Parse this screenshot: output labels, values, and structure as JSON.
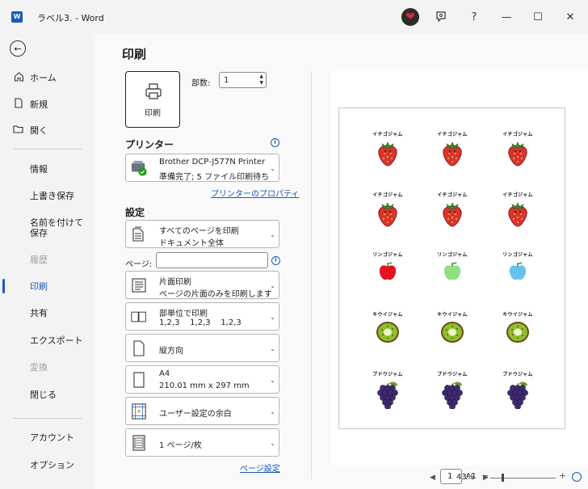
{
  "window": {
    "title": "ラベル3. - Word",
    "logo_letter": "W",
    "help_label": "?",
    "minimize_label": "—",
    "maximize_label": "☐",
    "close_label": "✕"
  },
  "sidebar": {
    "back_label": "←",
    "top_items": [
      {
        "label": "ホーム",
        "icon": "home-icon"
      },
      {
        "label": "新規",
        "icon": "new-document-icon"
      },
      {
        "label": "開く",
        "icon": "folder-open-icon"
      }
    ],
    "items": [
      {
        "label": "情報",
        "state": "normal"
      },
      {
        "label": "上書き保存",
        "state": "normal"
      },
      {
        "label": "名前を付けて保存",
        "state": "normal"
      },
      {
        "label": "履歴",
        "state": "disabled"
      },
      {
        "label": "印刷",
        "state": "active"
      },
      {
        "label": "共有",
        "state": "normal"
      },
      {
        "label": "エクスポート",
        "state": "normal"
      },
      {
        "label": "変換",
        "state": "disabled"
      },
      {
        "label": "閉じる",
        "state": "normal"
      }
    ],
    "bottom_items": [
      {
        "label": "アカウント"
      },
      {
        "label": "オプション"
      }
    ]
  },
  "print": {
    "title": "印刷",
    "print_button_label": "印刷",
    "copies_label": "部数:",
    "copies_value": "1",
    "printer_heading": "プリンター",
    "printer_name": "Brother DCP-J577N Printer",
    "printer_status": "準備完了; 5 ファイル印刷待ち",
    "printer_properties_link": "プリンターのプロパティ",
    "settings_heading": "設定",
    "pages_label": "ページ:",
    "page_setup_link": "ページ設定",
    "settings": [
      {
        "name": "print-range",
        "line1": "すべてのページを印刷",
        "line2": "ドキュメント全体",
        "icon": "pages-icon"
      },
      {
        "name": "sides",
        "line1": "片面印刷",
        "line2": "ページの片面のみを印刷します",
        "icon": "one-sided-icon"
      },
      {
        "name": "collation",
        "line1": "部単位で印刷",
        "line2": "1,2,3    1,2,3    1,2,3",
        "icon": "collate-icon"
      },
      {
        "name": "orientation",
        "line1": "縦方向",
        "line2": "",
        "icon": "portrait-icon"
      },
      {
        "name": "paper-size",
        "line1": "A4",
        "line2": "210.01 mm x 297 mm",
        "icon": "paper-size-icon"
      },
      {
        "name": "margins",
        "line1": "ユーザー設定の余白",
        "line2": "",
        "icon": "margins-icon"
      },
      {
        "name": "pages-per-sheet",
        "line1": "1 ページ/枚",
        "line2": "",
        "icon": "pages-per-sheet-icon"
      }
    ]
  },
  "preview": {
    "rows": [
      {
        "label": "イチゴジャム",
        "fruit": "strawberry"
      },
      {
        "label": "イチゴジャム",
        "fruit": "strawberry"
      },
      {
        "label": "リンゴジャム",
        "fruit": "apple"
      },
      {
        "label": "キウイジャム",
        "fruit": "kiwi"
      },
      {
        "label": "ブドウジャム",
        "fruit": "grape"
      }
    ],
    "apple_colors": [
      "#e5131f",
      "#8ee080",
      "#66c4ec"
    ],
    "page_value": "1",
    "page_of": "/ 1",
    "zoom": "43%"
  }
}
